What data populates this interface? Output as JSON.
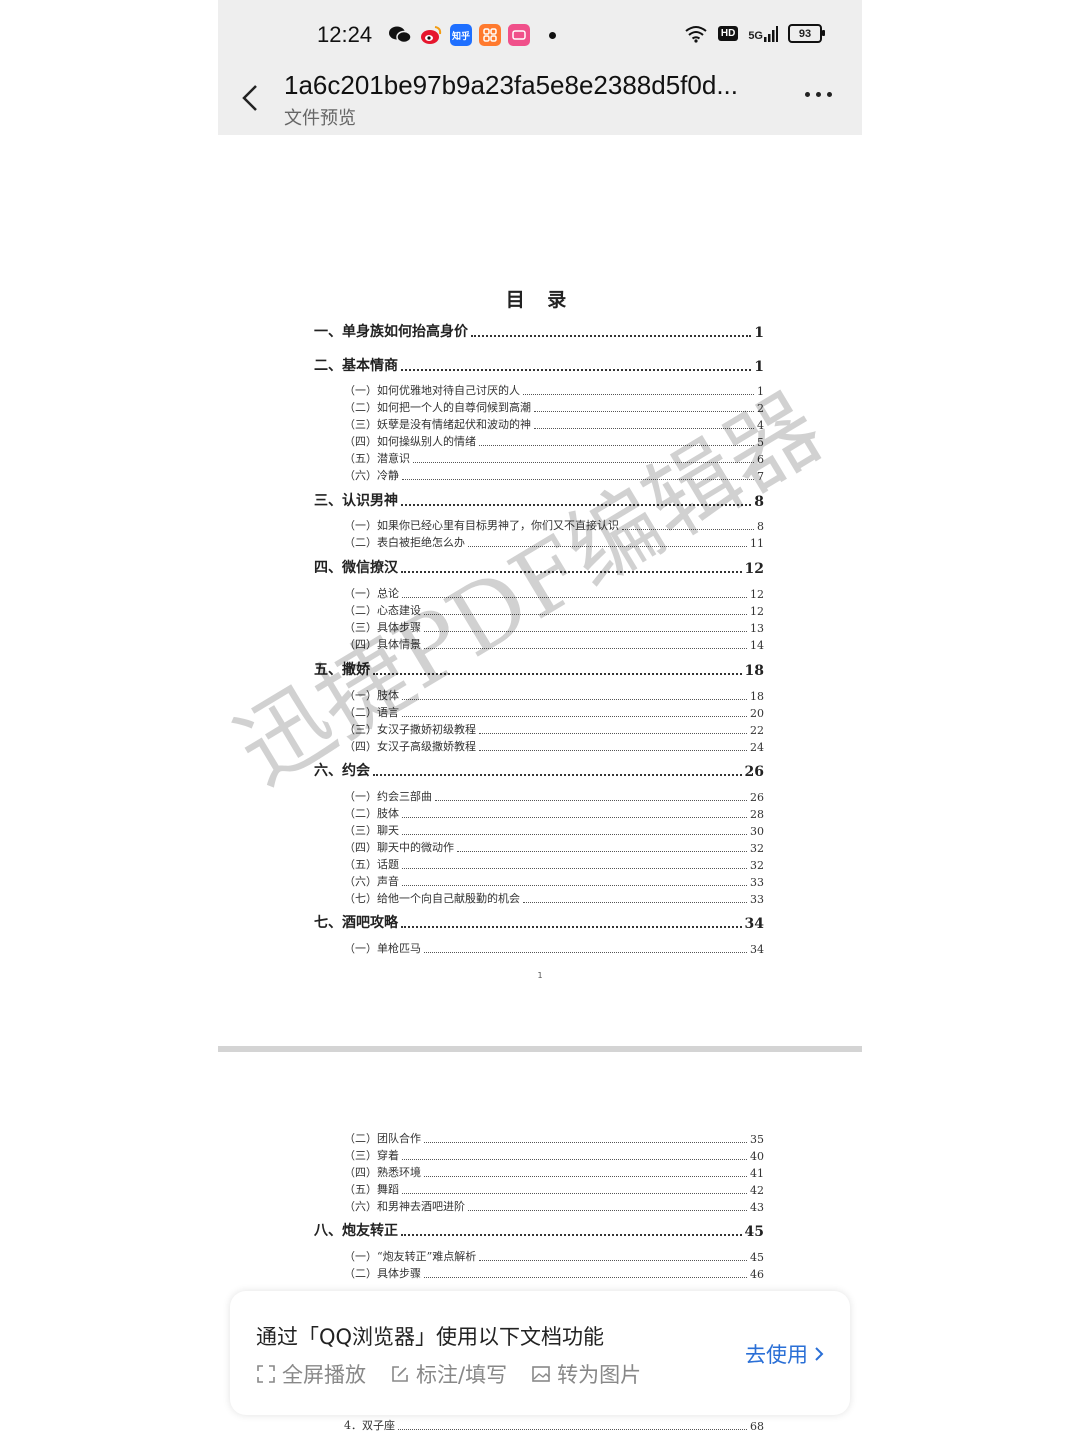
{
  "status_bar": {
    "time": "12:24",
    "apps": [
      "wechat-icon",
      "weibo-icon",
      "zhihu-icon",
      "app-grid-icon",
      "pink-app-icon"
    ],
    "zhihu_label": "知乎",
    "network": "5G",
    "hd": "HD",
    "battery": "93"
  },
  "header": {
    "title": "1a6c201be97b9a23fa5e8e2388d5f0d...",
    "subtitle": "文件预览"
  },
  "document": {
    "toc_title": "目 录",
    "page1_number": "1",
    "watermark": "迅捷PDF编辑器",
    "toc_page1": [
      {
        "level": "major",
        "text": "一、单身族如何抬高身价",
        "page": "1"
      },
      {
        "level": "major",
        "text": "二、基本情商",
        "page": "1"
      },
      {
        "level": "minor",
        "text": "（一）如何优雅地对待自己讨厌的人",
        "page": "1"
      },
      {
        "level": "minor",
        "text": "（二）如何把一个人的自尊伺候到高潮",
        "page": "2"
      },
      {
        "level": "minor",
        "text": "（三）妖孽是没有情绪起伏和波动的神",
        "page": "4"
      },
      {
        "level": "minor",
        "text": "（四）如何操纵别人的情绪",
        "page": "5"
      },
      {
        "level": "minor",
        "text": "（五）潜意识",
        "page": "6"
      },
      {
        "level": "minor",
        "text": "（六）冷静",
        "page": "7"
      },
      {
        "level": "major",
        "text": "三、认识男神",
        "page": "8"
      },
      {
        "level": "minor",
        "text": "（一）如果你已经心里有目标男神了，你们又不直接认识",
        "page": "8"
      },
      {
        "level": "minor",
        "text": "（二）表白被拒绝怎么办",
        "page": "11"
      },
      {
        "level": "major",
        "text": "四、微信撩汉",
        "page": "12"
      },
      {
        "level": "minor",
        "text": "（一）总论",
        "page": "12"
      },
      {
        "level": "minor",
        "text": "（二）心态建设",
        "page": "12"
      },
      {
        "level": "minor",
        "text": "（三）具体步骤",
        "page": "13"
      },
      {
        "level": "minor",
        "text": "（四）具体情景",
        "page": "14"
      },
      {
        "level": "major",
        "text": "五、撒娇",
        "page": "18"
      },
      {
        "level": "minor",
        "text": "（一）肢体",
        "page": "18"
      },
      {
        "level": "minor",
        "text": "（二）语言",
        "page": "20"
      },
      {
        "level": "minor",
        "text": "（三）女汉子撒娇初级教程",
        "page": "22"
      },
      {
        "level": "minor",
        "text": "（四）女汉子高级撒娇教程",
        "page": "24"
      },
      {
        "level": "major",
        "text": "六、约会",
        "page": "26"
      },
      {
        "level": "minor",
        "text": "（一）约会三部曲",
        "page": "26"
      },
      {
        "level": "minor",
        "text": "（二）肢体",
        "page": "28"
      },
      {
        "level": "minor",
        "text": "（三）聊天",
        "page": "30"
      },
      {
        "level": "minor",
        "text": "（四）聊天中的微动作",
        "page": "32"
      },
      {
        "level": "minor",
        "text": "（五）话题",
        "page": "32"
      },
      {
        "level": "minor",
        "text": "（六）声音",
        "page": "33"
      },
      {
        "level": "minor",
        "text": "（七）给他一个向自己献殷勤的机会",
        "page": "33"
      },
      {
        "level": "major",
        "text": "七、酒吧攻略",
        "page": "34"
      },
      {
        "level": "minor",
        "text": "（一）单枪匹马",
        "page": "34"
      }
    ],
    "toc_page2": [
      {
        "level": "minor",
        "text": "（二）团队合作",
        "page": "35"
      },
      {
        "level": "minor",
        "text": "（三）穿着",
        "page": "40"
      },
      {
        "level": "minor",
        "text": "（四）熟悉环境",
        "page": "41"
      },
      {
        "level": "minor",
        "text": "（五）舞蹈",
        "page": "42"
      },
      {
        "level": "minor",
        "text": "（六）和男神去酒吧进阶",
        "page": "43"
      },
      {
        "level": "major",
        "text": "八、炮友转正",
        "page": "45"
      },
      {
        "level": "minor",
        "text": "（一）“炮友转正”难点解析",
        "page": "45"
      },
      {
        "level": "minor",
        "text": "（二）具体步骤",
        "page": "46"
      },
      {
        "level": "minor",
        "text": "4．双子座",
        "page": "68"
      }
    ]
  },
  "banner": {
    "title": "通过「QQ浏览器」使用以下文档功能",
    "features": [
      {
        "icon": "fullscreen-icon",
        "label": "全屏播放"
      },
      {
        "icon": "edit-icon",
        "label": "标注/填写"
      },
      {
        "icon": "image-icon",
        "label": "转为图片"
      }
    ],
    "action": "去使用"
  },
  "colors": {
    "accent": "#2a6fd6",
    "bar_bg": "#eeeeee"
  }
}
